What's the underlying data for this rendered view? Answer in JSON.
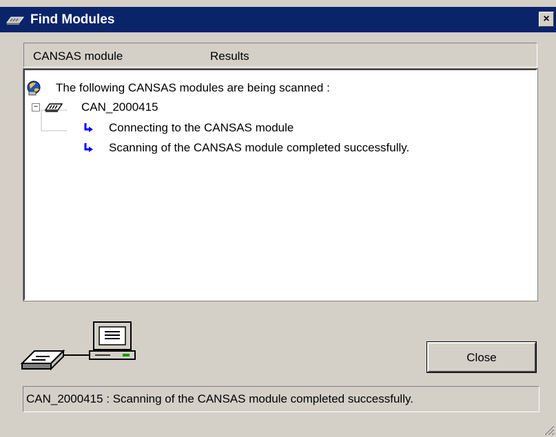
{
  "window": {
    "title": "Find Modules",
    "close_glyph": "×"
  },
  "columns": [
    "CANSAS module",
    "Results"
  ],
  "tree": {
    "root_label": "The following CANSAS modules are being scanned :",
    "module": {
      "label": "CAN_2000415",
      "expanded_glyph": "−",
      "steps": [
        "Connecting to the CANSAS module",
        "Scanning of the CANSAS module completed successfully."
      ]
    }
  },
  "close_button": {
    "label": "Close"
  },
  "status": {
    "text": "CAN_2000415 : Scanning of the CANSAS module completed successfully."
  },
  "icons": {
    "title": "cansas-module-icon",
    "root": "scan-globe-icon",
    "module": "cansas-module-icon",
    "step": "blue-arrow-icon",
    "illustration": "module-to-computer-icon"
  },
  "colors": {
    "titlebar": "#0a246a",
    "arrow": "#0000ff",
    "face": "#d4d0c8"
  }
}
